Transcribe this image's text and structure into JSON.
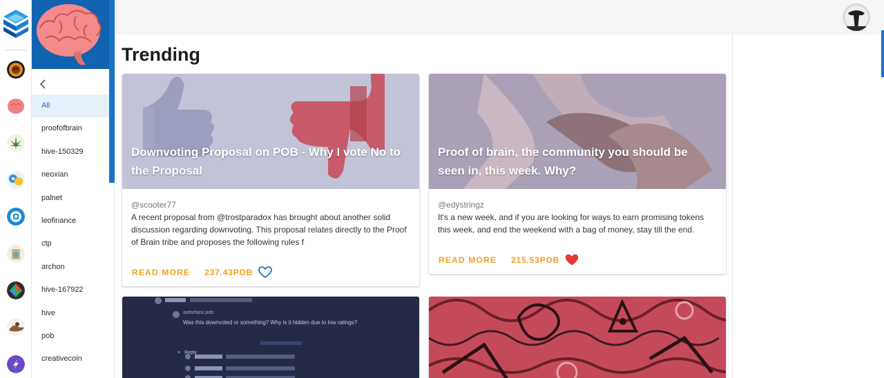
{
  "rail": {
    "icons": [
      "hive-logo-icon",
      "lion-community-icon",
      "brain-community-icon",
      "cannabis-community-icon",
      "neoxian-community-icon",
      "leofinance-community-icon",
      "ctp-community-icon",
      "archon-community-icon",
      "hive-community-icon",
      "pob-community-icon",
      "creativecoin-community-icon"
    ]
  },
  "sidebar": {
    "back_icon": "chevron-left-icon",
    "items": [
      {
        "label": "All",
        "active": true
      },
      {
        "label": "proofofbrain"
      },
      {
        "label": "hive-150329"
      },
      {
        "label": "neoxian"
      },
      {
        "label": "palnet"
      },
      {
        "label": "leofinance"
      },
      {
        "label": "ctp"
      },
      {
        "label": "archon"
      },
      {
        "label": "hive-167922"
      },
      {
        "label": "hive"
      },
      {
        "label": "pob"
      },
      {
        "label": "creativecoin"
      }
    ]
  },
  "main": {
    "title": "Trending",
    "posts": [
      {
        "title": "Downvoting Proposal on POB - Why I vote No to the Proposal",
        "author": "@scooter77",
        "excerpt": "A recent proposal from @trostparadox has brought about another solid discussion regarding downvoting. This proposal relates directly to the Proof of Brain tribe and proposes the following rules f",
        "read_more": "READ MORE",
        "payout": "237.43POB",
        "liked": false
      },
      {
        "title": "Proof of brain, the community you should be seen in, this week. Why?",
        "author": "@edystringz",
        "excerpt": "It's a new week, and if you are looking for ways to earn promising tokens this week, and end the weekend with a bag of money, stay till the end.",
        "read_more": "READ MORE",
        "payout": "215.53POB",
        "liked": true
      }
    ],
    "preview": {
      "author1": "minnopoly",
      "author2": "asthefans.pob",
      "comment": "Was this downvoted or something? Why is it hidden due to low ratings?",
      "reply": "Reply"
    }
  },
  "colors": {
    "accent": "#1a73c9",
    "payout": "#f0a020",
    "heart": "#e53935"
  }
}
